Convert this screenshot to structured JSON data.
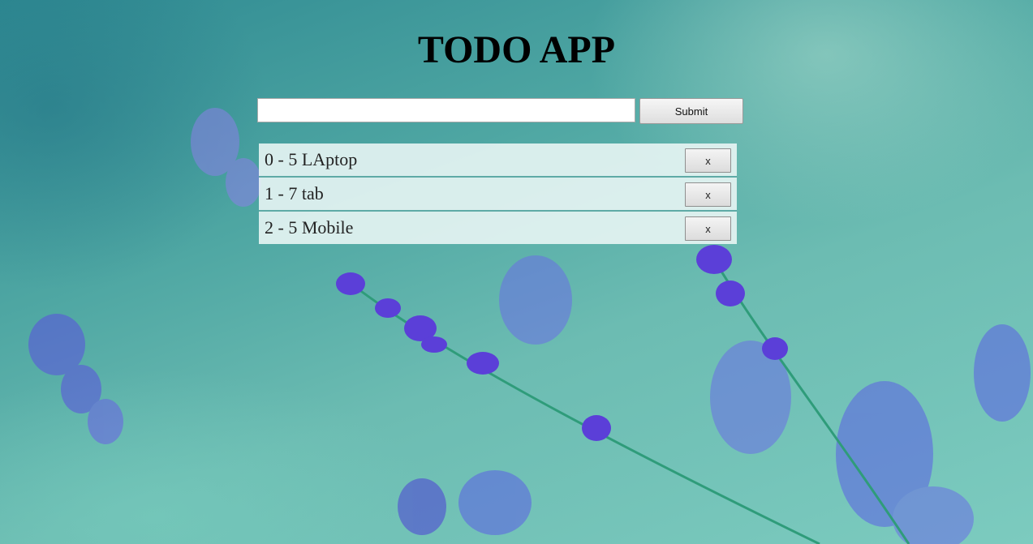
{
  "app": {
    "title": "TODO APP"
  },
  "form": {
    "input_value": "",
    "submit_label": "Submit"
  },
  "todos": [
    {
      "text": "0 - 5 LAptop",
      "delete_label": "x"
    },
    {
      "text": "1 - 7 tab",
      "delete_label": "x"
    },
    {
      "text": "2 - 5 Mobile",
      "delete_label": "x"
    }
  ],
  "colors": {
    "background": "#5fb2aa",
    "row_background": "#ecf7f6",
    "row_divider": "#5eaaa6",
    "flower": "#5b3fd8"
  }
}
